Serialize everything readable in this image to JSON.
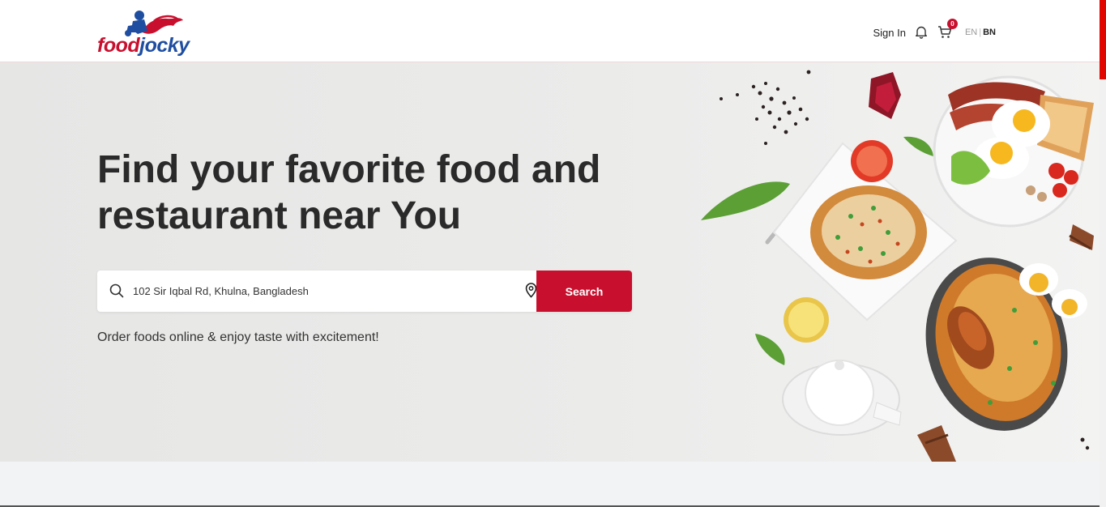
{
  "header": {
    "brand": {
      "food": "food",
      "jocky": "jocky"
    },
    "nav": {
      "signin_label": "Sign In",
      "notification_icon": "bell-icon",
      "cart_icon": "cart-icon",
      "cart_count": "0",
      "lang_en": "EN",
      "lang_sep": "|",
      "lang_bn": "BN"
    }
  },
  "hero": {
    "title_line1": "Find your favorite food and",
    "title_line2": "restaurant near You",
    "search": {
      "value": "102 Sir Iqbal Rd, Khulna, Bangladesh",
      "search_icon": "search-icon",
      "location_icon": "map-pin-icon",
      "button_label": "Search"
    },
    "subtitle": "Order foods online & enjoy taste with excitement!"
  },
  "colors": {
    "brand_red": "#c8102e",
    "brand_blue": "#1f4ea1",
    "text_dark": "#2a2a2a"
  }
}
